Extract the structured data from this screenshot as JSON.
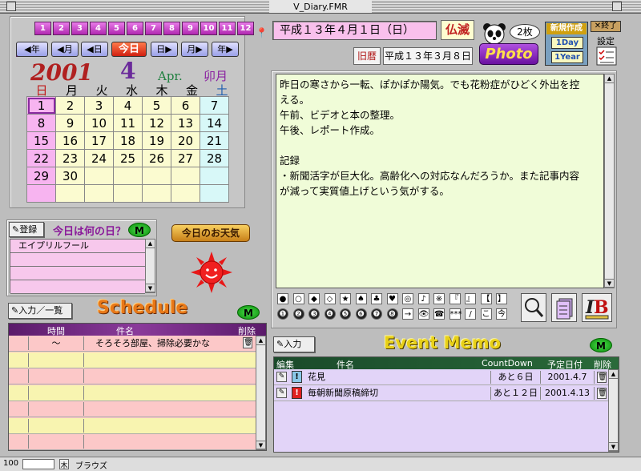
{
  "window": {
    "title": "V_Diary.FMR"
  },
  "months": [
    "1",
    "2",
    "3",
    "4",
    "5",
    "6",
    "7",
    "8",
    "9",
    "10",
    "11",
    "12"
  ],
  "nav": {
    "prev_year": "◀年",
    "prev_month": "◀月",
    "prev_day": "◀日",
    "today": "今日",
    "next_day": "日▶",
    "next_month": "月▶",
    "next_year": "年▶"
  },
  "calendar": {
    "year": "2001",
    "month": "4",
    "month_en": "Apr.",
    "month_jp": "卯月",
    "weekdays": [
      "日",
      "月",
      "火",
      "水",
      "木",
      "金",
      "土"
    ],
    "weeks": [
      [
        "1",
        "2",
        "3",
        "4",
        "5",
        "6",
        "7"
      ],
      [
        "8",
        "9",
        "10",
        "11",
        "12",
        "13",
        "14"
      ],
      [
        "15",
        "16",
        "17",
        "18",
        "19",
        "20",
        "21"
      ],
      [
        "22",
        "23",
        "24",
        "25",
        "26",
        "27",
        "28"
      ],
      [
        "29",
        "30",
        "",
        "",
        "",
        "",
        ""
      ],
      [
        "",
        "",
        "",
        "",
        "",
        "",
        ""
      ]
    ]
  },
  "header": {
    "date": "平成１３年４月１日（日）",
    "rokuyo": "仏滅",
    "lunar_label": "旧暦",
    "lunar_date": "平成１３年３月８日"
  },
  "photo": {
    "count": "2枚",
    "label": "Photo"
  },
  "create": {
    "title": "新規作成",
    "one_day": "1Day",
    "one_year": "1Year",
    "exit": "終了",
    "settings": "設定"
  },
  "diary": {
    "lines": [
      "昨日の寒さから一転、ぽかぽか陽気。でも花粉症がひどく外出を控",
      "える。",
      "午前、ビデオと本の整理。",
      "午後、レポート作成。",
      "",
      "記録",
      "・新聞活字が巨大化。高齢化への対応なんだろうか。また記事内容",
      "が減って実質値上げという気がする。"
    ]
  },
  "symbols": {
    "row1": [
      "●",
      "○",
      "◆",
      "◇",
      "★",
      "♠",
      "♣",
      "♥",
      "◎",
      "♪",
      "※",
      "『",
      "』",
      "【",
      "】"
    ],
    "row2": [
      "❶",
      "❷",
      "❸",
      "❹",
      "❺",
      "❻",
      "❼",
      "❽",
      "→",
      "👁",
      "☎",
      "***",
      "/",
      "こ",
      "今"
    ]
  },
  "anniv": {
    "register": "登録",
    "title": "今日は何の日？",
    "m": "M",
    "items": [
      "エイプリルフール",
      "",
      "",
      ""
    ]
  },
  "weather": {
    "label": "今日のお天気"
  },
  "schedule": {
    "input_btn": "入力／一覧",
    "title": "Schedule",
    "m": "M",
    "col_time": "時間",
    "col_item": "件名",
    "col_delete": "削除",
    "rows": [
      {
        "time": "～",
        "item": "そろそろ部屋、掃除必要かな"
      },
      {
        "time": "",
        "item": ""
      },
      {
        "time": "",
        "item": ""
      },
      {
        "time": "",
        "item": ""
      },
      {
        "time": "",
        "item": ""
      },
      {
        "time": "",
        "item": ""
      },
      {
        "time": "",
        "item": ""
      }
    ]
  },
  "event": {
    "input_btn": "入力",
    "title": "Event Memo",
    "m": "M",
    "col_edit": "編集",
    "col_item": "件名",
    "col_count": "CountDown",
    "col_date": "予定日付",
    "col_delete": "削除",
    "rows": [
      {
        "flag": "!",
        "item": "花見",
        "count": "あと６日",
        "date": "2001.4.7"
      },
      {
        "flag": "!",
        "item": "毎朝新聞原稿締切",
        "count": "あと１２日",
        "date": "2001.4.13"
      }
    ]
  },
  "status": {
    "zoom": "100",
    "mode": "ブラウズ"
  },
  "colors": {
    "pink": "#f7b4f0",
    "yellow": "#fbfbd0",
    "cyan": "#d8f8f8",
    "purple": "#b028b0",
    "lavender": "#e2d4f8",
    "schedule_pink": "#fcc8c8"
  }
}
